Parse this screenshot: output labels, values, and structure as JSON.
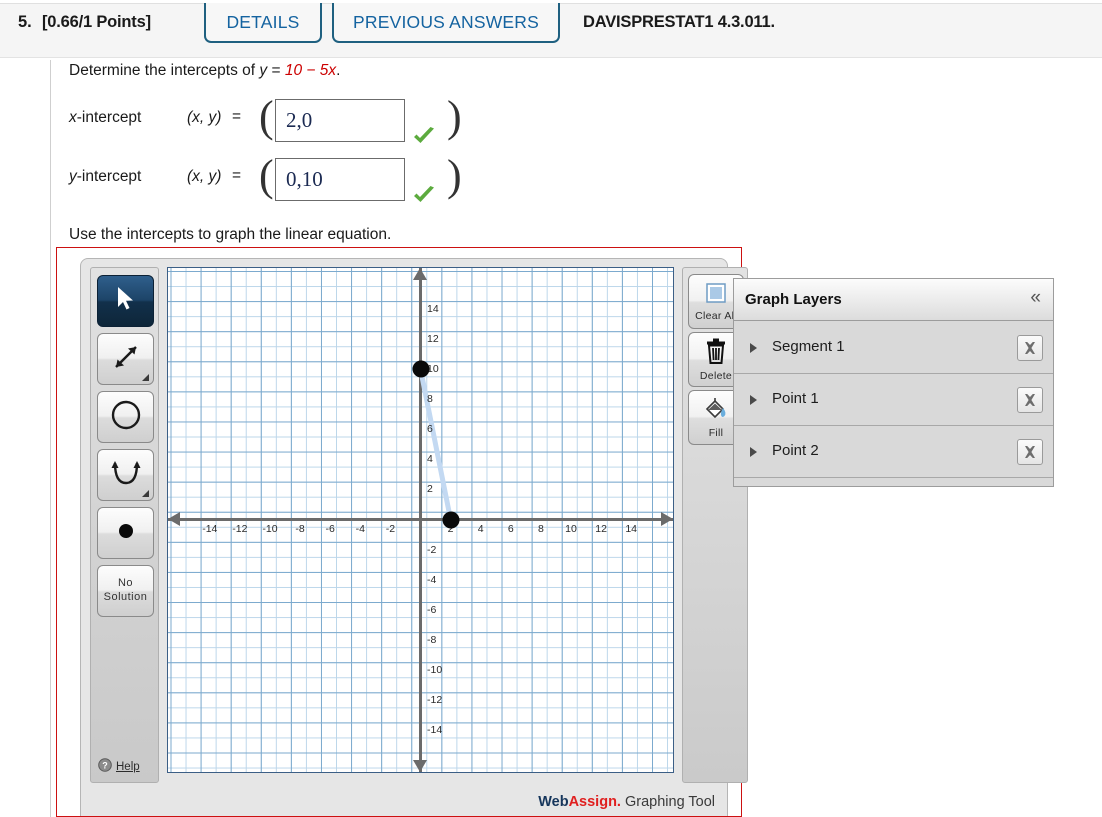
{
  "header": {
    "problem_number": "5.",
    "points_label": "[0.66/1 Points]",
    "tabs": [
      {
        "id": "details",
        "label": "DETAILS"
      },
      {
        "id": "previous-answers",
        "label": "PREVIOUS ANSWERS"
      }
    ],
    "assignment_code": "DAVISPRESTAT1 4.3.011."
  },
  "question": {
    "prompt_prefix": "Determine the intercepts of ",
    "equation_y": "y",
    "equation_eq": " = ",
    "equation_rhs": "10 − 5x",
    "equation_period": ".",
    "rows": [
      {
        "id": "x-intercept",
        "label_var": "x",
        "label_rest": "-intercept",
        "coords": "(x, y)",
        "equals": "=",
        "value": "2,0",
        "placeholder": "",
        "status": "correct"
      },
      {
        "id": "y-intercept",
        "label_var": "y",
        "label_rest": "-intercept",
        "coords": "(x, y)",
        "equals": "=",
        "value": "0,10",
        "placeholder": "",
        "status": "correct"
      }
    ],
    "graph_instruction": "Use the intercepts to graph the linear equation."
  },
  "graphing_tool": {
    "tools": [
      {
        "id": "select",
        "icon": "cursor-arrow-icon",
        "label": "",
        "selected": true,
        "has_submenu": false
      },
      {
        "id": "line",
        "icon": "line-segment-icon",
        "label": "",
        "selected": false,
        "has_submenu": true
      },
      {
        "id": "circle",
        "icon": "circle-icon",
        "label": "",
        "selected": false,
        "has_submenu": false
      },
      {
        "id": "parabola",
        "icon": "parabola-icon",
        "label": "",
        "selected": false,
        "has_submenu": true
      },
      {
        "id": "point",
        "icon": "dot-point-icon",
        "label": "",
        "selected": false,
        "has_submenu": false
      },
      {
        "id": "nosolution",
        "icon": "",
        "label": "No Solution",
        "selected": false,
        "has_submenu": false
      }
    ],
    "help_label": "Help",
    "actions": [
      {
        "id": "clear-all",
        "label": "Clear All",
        "icon": "clear-square-icon"
      },
      {
        "id": "delete",
        "label": "Delete",
        "icon": "trash-icon"
      },
      {
        "id": "fill",
        "label": "Fill",
        "icon": "paint-bucket-icon"
      }
    ],
    "branding": {
      "web": "Web",
      "assign": "Assign.",
      "tool": " Graphing Tool"
    }
  },
  "chart_data": {
    "type": "line",
    "title": "",
    "xlabel": "",
    "ylabel": "",
    "xlim": [
      -16,
      16
    ],
    "ylim": [
      -16,
      16
    ],
    "xticks": [
      -14,
      -12,
      -10,
      -8,
      -6,
      -4,
      -2,
      2,
      4,
      6,
      8,
      10,
      12,
      14
    ],
    "yticks": [
      14,
      12,
      10,
      8,
      6,
      4,
      2,
      -2,
      -4,
      -6,
      -8,
      -10,
      -12,
      -14
    ],
    "xtick_labels": [
      "-14",
      "-12",
      "-10",
      "-8",
      "-6",
      "-4",
      "-2",
      "2",
      "4",
      "6",
      "8",
      "10",
      "12",
      "14"
    ],
    "ytick_labels": [
      "14",
      "12",
      "10",
      "8",
      "6",
      "4",
      "2",
      "-2",
      "-4",
      "-6",
      "-8",
      "-10",
      "-12",
      "-14"
    ],
    "grid": true,
    "grid_minor_step": 1,
    "grid_major_step": 2,
    "legend": false,
    "series": [
      {
        "name": "Segment 1",
        "type": "segment",
        "color": "#c3d9f2",
        "x": [
          0,
          2
        ],
        "y": [
          10,
          0
        ]
      }
    ],
    "points": [
      {
        "name": "Point 1",
        "x": 0,
        "y": 10,
        "color": "#0a0a0a"
      },
      {
        "name": "Point 2",
        "x": 2,
        "y": 0,
        "color": "#0a0a0a"
      }
    ]
  },
  "graph_layers": {
    "title": "Graph Layers",
    "collapse_icon": "«",
    "rows": [
      {
        "id": "segment-1",
        "label": "Segment 1"
      },
      {
        "id": "point-1",
        "label": "Point 1"
      },
      {
        "id": "point-2",
        "label": "Point 2"
      }
    ]
  },
  "colors": {
    "tab_border": "#1f6080",
    "tab_text": "#1463a0",
    "equation_red": "#cc0000",
    "frame_red": "#cc1111",
    "check_green": "#5cab3e",
    "segment_blue": "#c3d9f2",
    "grid_minor": "#bcd6ea",
    "grid_major": "#7ba9cd",
    "axis_gray": "#6b6b6b"
  }
}
